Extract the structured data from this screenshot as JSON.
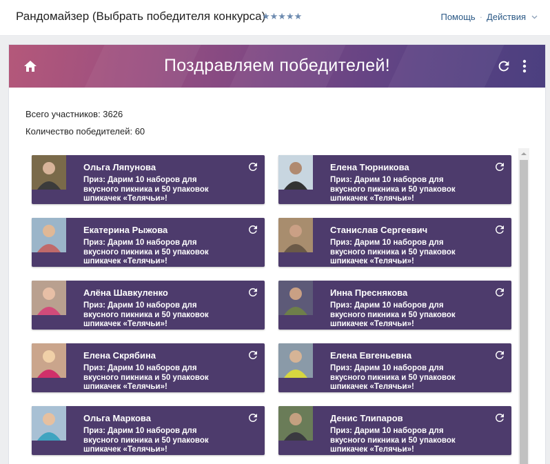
{
  "header": {
    "title": "Рандомайзер (Выбрать победителя конкурса)",
    "rating_stars": "★★★★★",
    "help_label": "Помощь",
    "separator": "·",
    "actions_label": "Действия"
  },
  "banner": {
    "title": "Поздравляем победителей!"
  },
  "stats": {
    "participants": "Всего участников: 3626",
    "winners": "Количество победителей: 60"
  },
  "colors": {
    "card_bg": "#4d3b6c",
    "banner_start": "#b4587a",
    "banner_end": "#4b3f7f",
    "link": "#2a5885"
  },
  "winners": [
    {
      "name": "Ольга Ляпунова",
      "prize": "Приз: Дарим 10 наборов для вкусного пикника и 50 упаковок шпикачек «Телячьи»!"
    },
    {
      "name": "Елена Тюрникова",
      "prize": "Приз: Дарим 10 наборов для вкусного пикника и 50 упаковок шпикачек «Телячьи»!"
    },
    {
      "name": "Екатерина Рыжова",
      "prize": "Приз: Дарим 10 наборов для вкусного пикника и 50 упаковок шпикачек «Телячьи»!"
    },
    {
      "name": "Станислав Сергеевич",
      "prize": "Приз: Дарим 10 наборов для вкусного пикника и 50 упаковок шпикачек «Телячьи»!"
    },
    {
      "name": "Алёна Шавкуленко",
      "prize": "Приз: Дарим 10 наборов для вкусного пикника и 50 упаковок шпикачек «Телячьи»!"
    },
    {
      "name": "Инна Преснякова",
      "prize": "Приз: Дарим 10 наборов для вкусного пикника и 50 упаковок шпикачек «Телячьи»!"
    },
    {
      "name": "Елена Скрябина",
      "prize": "Приз: Дарим 10 наборов для вкусного пикника и 50 упаковок шпикачек «Телячьи»!"
    },
    {
      "name": "Елена Евгеньевна",
      "prize": "Приз: Дарим 10 наборов для вкусного пикника и 50 упаковок шпикачек «Телячьи»!"
    },
    {
      "name": "Ольга Маркова",
      "prize": "Приз: Дарим 10 наборов для вкусного пикника и 50 упаковок шпикачек «Телячьи»!"
    },
    {
      "name": "Денис Тлипаров",
      "prize": "Приз: Дарим 10 наборов для вкусного пикника и 50 упаковок шпикачек «Телячьи»!"
    }
  ]
}
